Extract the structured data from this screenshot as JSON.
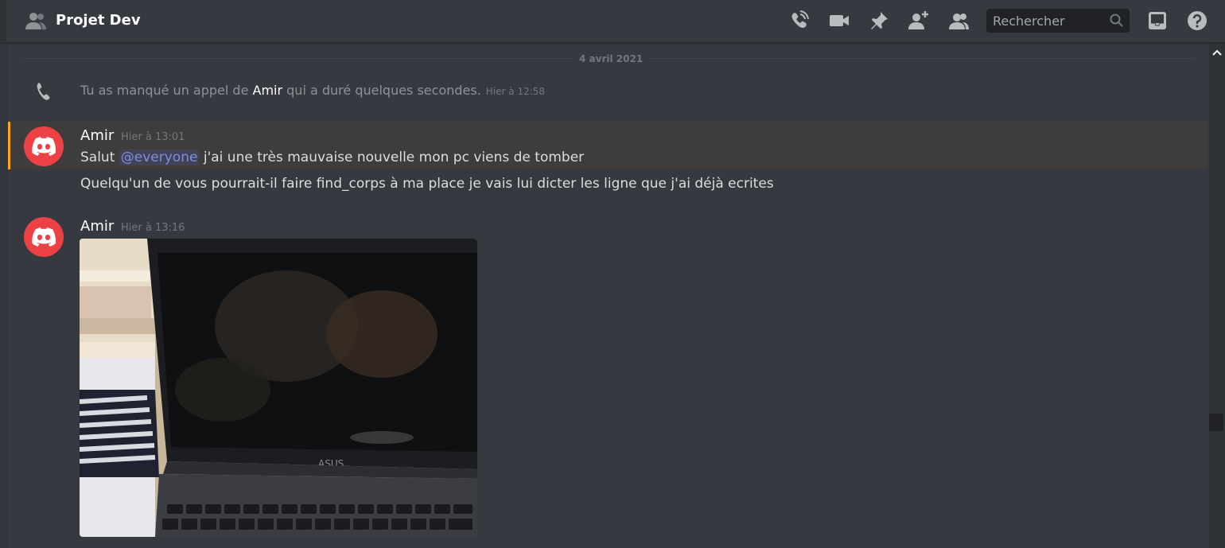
{
  "header": {
    "channel_name": "Projet Dev",
    "search_placeholder": "Rechercher",
    "icons": [
      "group-dm-icon",
      "start-voice-call-icon",
      "start-video-call-icon",
      "pinned-messages-icon",
      "add-friends-icon",
      "member-list-icon",
      "search-icon",
      "inbox-icon",
      "help-icon"
    ]
  },
  "messages": {
    "date_divider": "4 avril 2021",
    "missed_call": {
      "prefix": "Tu as manqué un appel de ",
      "name": "Amir",
      "suffix": " qui a duré quelques secondes.",
      "time": "Hier à 12:58"
    },
    "group1": {
      "author": "Amir",
      "time": "Hier à 13:01",
      "line1_prefix": "Salut ",
      "mention": "@everyone",
      "line1_suffix": " j'ai une très mauvaise nouvelle mon pc viens de tomber",
      "line2": "Quelqu'un de vous pourrait-il faire find_corps à ma place je vais lui dicter les ligne que j'ai déjà ecrites"
    },
    "group2": {
      "author": "Amir",
      "time": "Hier à 13:16"
    }
  },
  "colors": {
    "background": "#36393f",
    "avatar": "#ed4245",
    "mention": "#7d8fe0",
    "highlight_bar": "#faa81a"
  }
}
